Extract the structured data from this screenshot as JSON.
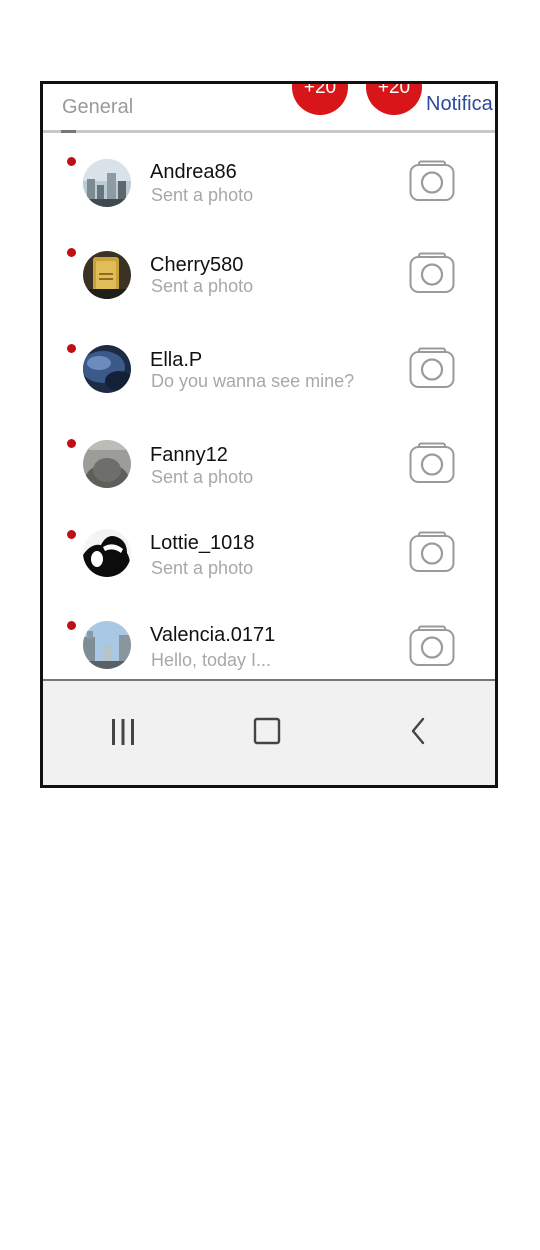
{
  "tabs": {
    "general_label": "General",
    "notifications_label": "Notifica",
    "badge_1": "+20",
    "badge_2": "+20"
  },
  "colors": {
    "unread_dot": "#c01017",
    "badge": "#d8161a",
    "notifications_tab": "#2b4a9a"
  },
  "conversations": [
    {
      "name": "Andrea86",
      "preview": "Sent a photo",
      "unread": true,
      "avatar_icon": "city-skyline-avatar",
      "action_icon": "camera-icon"
    },
    {
      "name": "Cherry580",
      "preview": "Sent a photo",
      "unread": true,
      "avatar_icon": "gold-bar-avatar",
      "action_icon": "camera-icon"
    },
    {
      "name": "Ella.P",
      "preview": "Do you wanna see mine?",
      "unread": true,
      "avatar_icon": "blue-fabric-avatar",
      "action_icon": "camera-icon"
    },
    {
      "name": "Fanny12",
      "preview": "Sent a photo",
      "unread": true,
      "avatar_icon": "person-sweater-avatar",
      "action_icon": "camera-icon"
    },
    {
      "name": "Lottie_1018",
      "preview": "Sent a photo",
      "unread": true,
      "avatar_icon": "silhouette-avatar",
      "action_icon": "camera-icon"
    },
    {
      "name": "Valencia.0171",
      "preview": "Hello, today I...",
      "unread": true,
      "avatar_icon": "street-avatar",
      "action_icon": "camera-icon"
    }
  ],
  "navbar": {
    "recents_icon": "recents-icon",
    "home_icon": "home-icon",
    "back_icon": "back-icon"
  }
}
